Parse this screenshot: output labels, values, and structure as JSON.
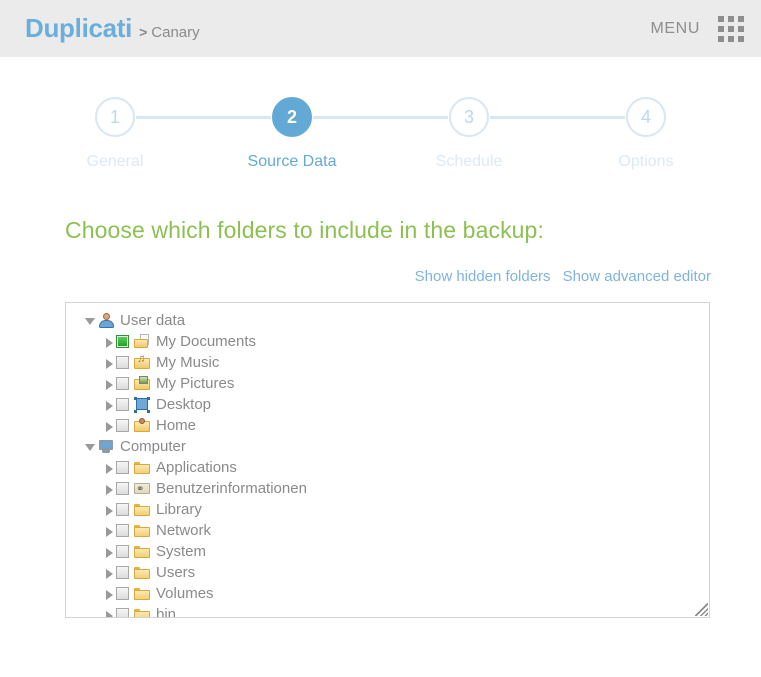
{
  "header": {
    "brand": "Duplicati",
    "breadcrumb_separator": ">",
    "breadcrumb_item": "Canary",
    "menu_label": "MENU",
    "menu_icon": "grid-apps-icon",
    "background_color": "#ebebeb",
    "brand_color": "#6aaedb"
  },
  "stepper": {
    "active_index": 1,
    "steps": [
      {
        "number": "1",
        "label": "General"
      },
      {
        "number": "2",
        "label": "Source Data"
      },
      {
        "number": "3",
        "label": "Schedule"
      },
      {
        "number": "4",
        "label": "Options"
      }
    ],
    "active_color": "#63a9d6",
    "inactive_color": "#d7e7f4"
  },
  "main": {
    "section_title": "Choose which folders to include in the backup:",
    "section_title_color": "#8cc152",
    "links": [
      {
        "label": "Show hidden folders",
        "name": "show-hidden-folders-link"
      },
      {
        "label": "Show advanced editor",
        "name": "show-advanced-editor-link"
      }
    ],
    "link_color": "#7fb4dd"
  },
  "tree": {
    "nodes": [
      {
        "label": "User data",
        "level": 0,
        "expanded": true,
        "twisty": "down",
        "checkbox": null,
        "icon": "user-person-icon"
      },
      {
        "label": "My Documents",
        "level": 1,
        "expanded": false,
        "twisty": "right",
        "checkbox": true,
        "icon": "documents-folder-icon"
      },
      {
        "label": "My Music",
        "level": 1,
        "expanded": false,
        "twisty": "right",
        "checkbox": false,
        "icon": "music-folder-icon"
      },
      {
        "label": "My Pictures",
        "level": 1,
        "expanded": false,
        "twisty": "right",
        "checkbox": false,
        "icon": "pictures-folder-icon"
      },
      {
        "label": "Desktop",
        "level": 1,
        "expanded": false,
        "twisty": "right",
        "checkbox": false,
        "icon": "desktop-icon"
      },
      {
        "label": "Home",
        "level": 1,
        "expanded": false,
        "twisty": "right",
        "checkbox": false,
        "icon": "home-folder-icon"
      },
      {
        "label": "Computer",
        "level": 0,
        "expanded": true,
        "twisty": "down",
        "checkbox": null,
        "icon": "computer-monitor-icon"
      },
      {
        "label": "Applications",
        "level": 1,
        "expanded": false,
        "twisty": "right",
        "checkbox": false,
        "icon": "folder-icon"
      },
      {
        "label": "Benutzerinformationen",
        "level": 1,
        "expanded": false,
        "twisty": "right",
        "checkbox": false,
        "icon": "alias-folder-icon"
      },
      {
        "label": "Library",
        "level": 1,
        "expanded": false,
        "twisty": "right",
        "checkbox": false,
        "icon": "folder-icon"
      },
      {
        "label": "Network",
        "level": 1,
        "expanded": false,
        "twisty": "right",
        "checkbox": false,
        "icon": "folder-icon"
      },
      {
        "label": "System",
        "level": 1,
        "expanded": false,
        "twisty": "right",
        "checkbox": false,
        "icon": "folder-icon"
      },
      {
        "label": "Users",
        "level": 1,
        "expanded": false,
        "twisty": "right",
        "checkbox": false,
        "icon": "folder-icon"
      },
      {
        "label": "Volumes",
        "level": 1,
        "expanded": false,
        "twisty": "right",
        "checkbox": false,
        "icon": "folder-icon"
      },
      {
        "label": "bin",
        "level": 1,
        "expanded": false,
        "twisty": "right",
        "checkbox": false,
        "icon": "folder-icon"
      }
    ],
    "resize_handle": "resize-grip-icon"
  }
}
